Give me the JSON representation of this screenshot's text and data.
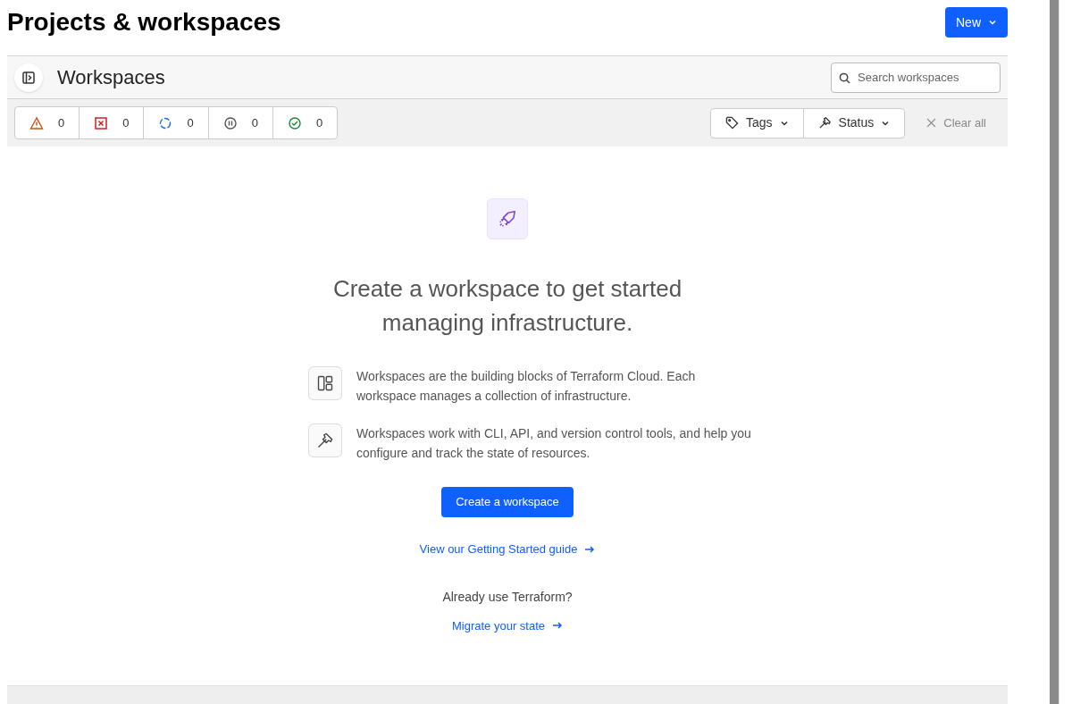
{
  "page_title": "Projects & workspaces",
  "new_button": {
    "label": "New"
  },
  "header": {
    "title": "Workspaces",
    "search": {
      "placeholder": "Search workspaces"
    }
  },
  "status_counts": [
    {
      "kind": "warning",
      "count": "0"
    },
    {
      "kind": "errored",
      "count": "0"
    },
    {
      "kind": "running",
      "count": "0"
    },
    {
      "kind": "paused",
      "count": "0"
    },
    {
      "kind": "applied",
      "count": "0"
    }
  ],
  "filters": [
    {
      "kind": "tags",
      "label": "Tags"
    },
    {
      "kind": "status",
      "label": "Status"
    }
  ],
  "clear_all": "Clear all",
  "empty_state": {
    "heading_line_1": "Create a workspace to get started",
    "heading_line_2": "managing infrastructure.",
    "features": [
      {
        "kind": "blocks",
        "text": "Workspaces are the building blocks of Terraform Cloud. Each workspace manages a collection of infrastructure."
      },
      {
        "kind": "hammer",
        "text": "Workspaces work with CLI, API, and version control tools, and help you configure and track the state of resources."
      }
    ],
    "create_button": "Create a workspace",
    "guide_link": "View our Getting Started guide",
    "already_text": "Already use Terraform?",
    "migrate_link": "Migrate your state"
  }
}
